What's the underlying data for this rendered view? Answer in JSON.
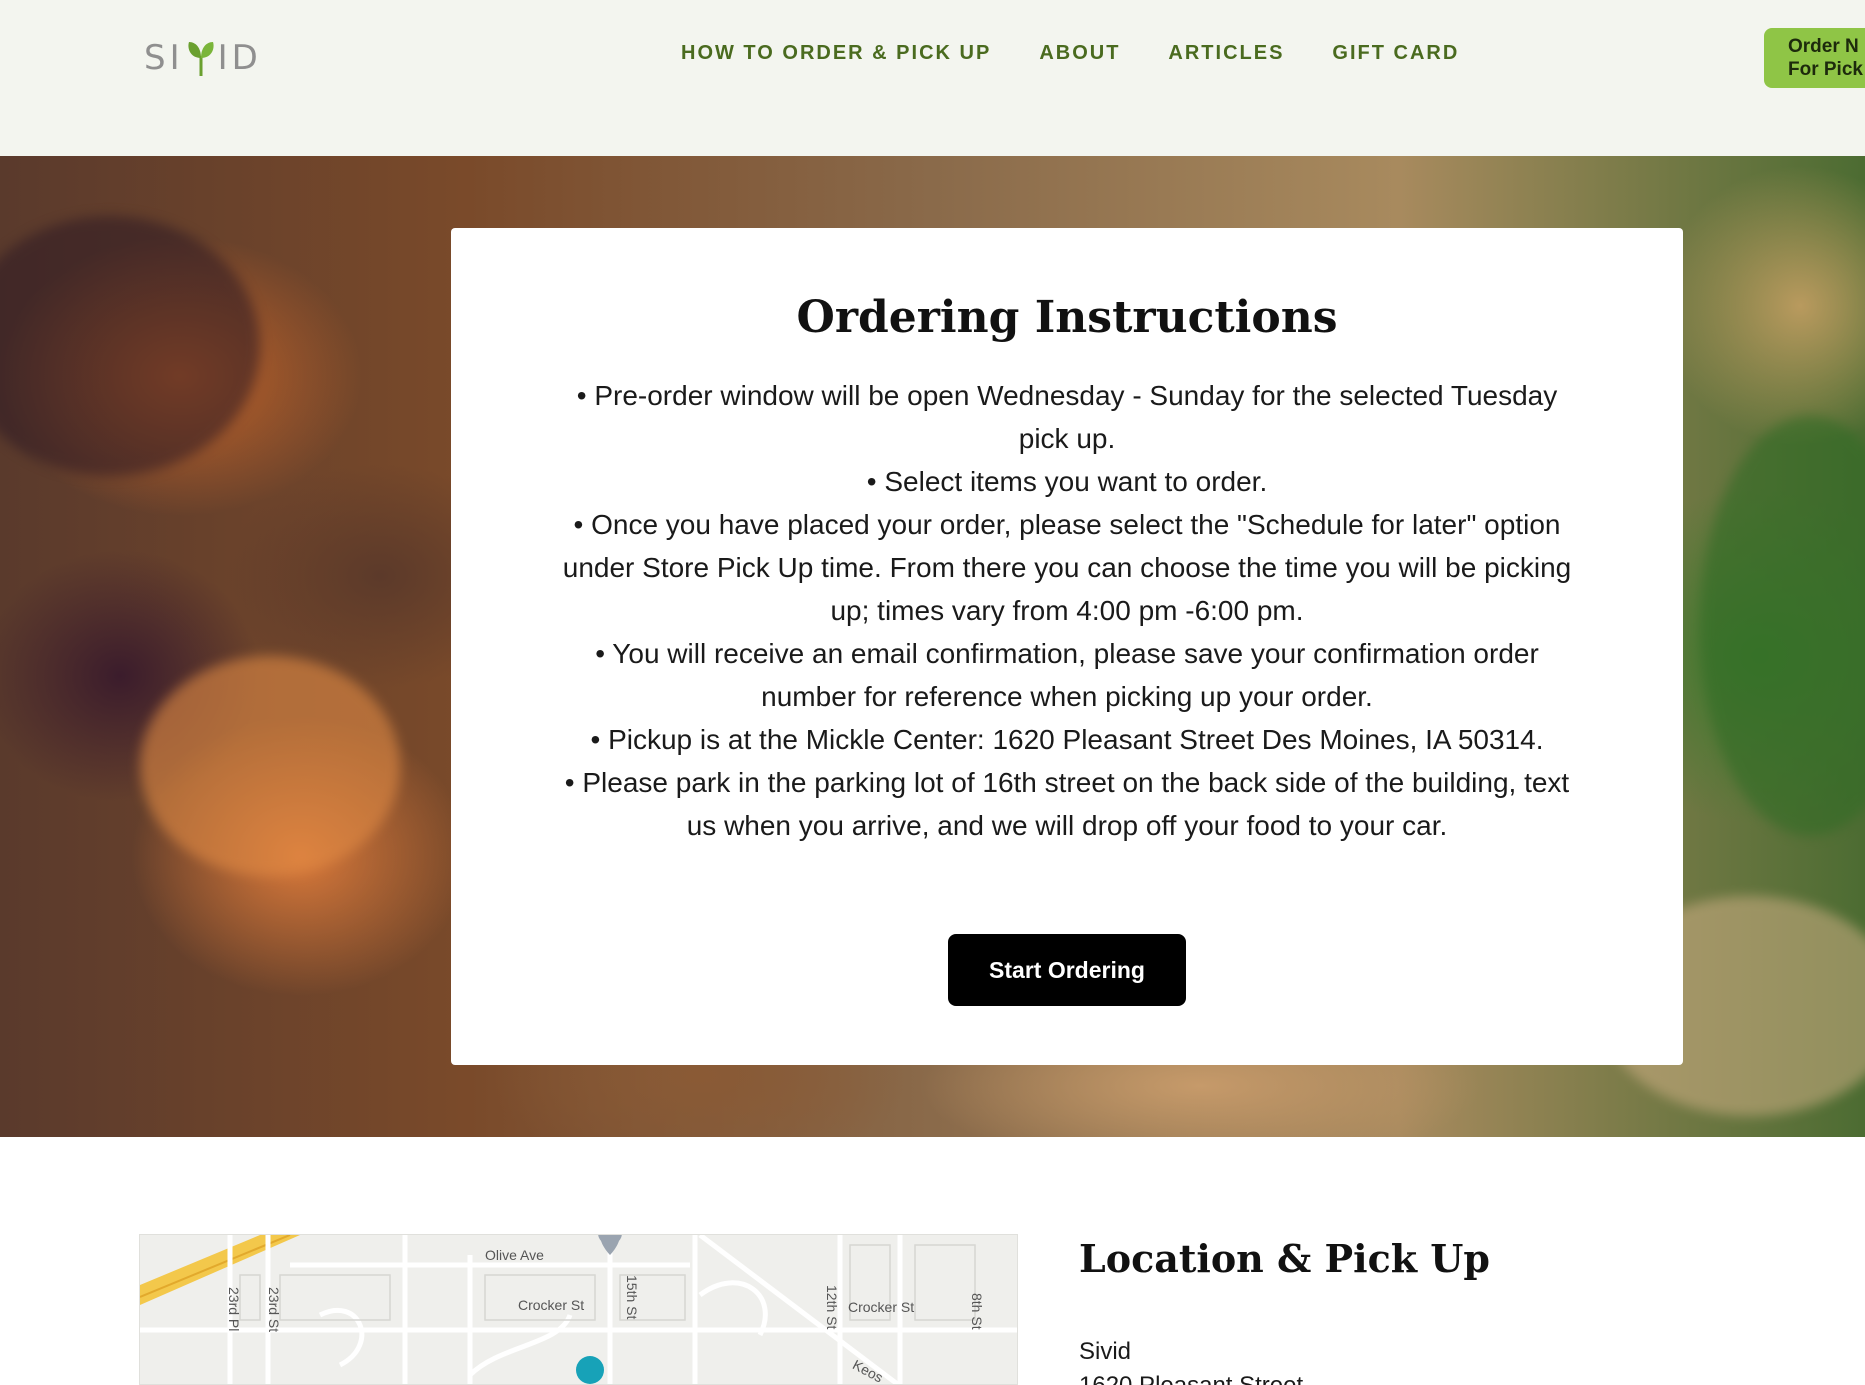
{
  "header": {
    "logo_text": "SIVID",
    "nav": [
      {
        "label": "HOW TO ORDER & PICK UP"
      },
      {
        "label": "ABOUT"
      },
      {
        "label": "ARTICLES"
      },
      {
        "label": "GIFT CARD"
      }
    ],
    "order_button_line1": "Order N",
    "order_button_line2": "For Pick"
  },
  "hero": {
    "title": "Ordering Instructions",
    "instructions": [
      "•  Pre-order window will be open Wednesday - Sunday for the selected Tuesday pick up.",
      "• Select items you want to order.",
      "• Once you have placed your order, please select the \"Schedule for later\" option under Store Pick Up time. From there you can choose the time you will be picking up; times vary from 4:00 pm -6:00 pm.",
      "• You will receive an email confirmation, please save your confirmation order number for reference when picking up your order.",
      "• Pickup is at the Mickle Center: 1620 Pleasant Street Des Moines, IA 50314.",
      "• Please park in the parking lot of 16th street on the back side of the building, text us when you arrive, and we will drop off your food to your car."
    ],
    "cta_label": "Start Ordering"
  },
  "map": {
    "labels": {
      "olive": "Olive Ave",
      "crocker1": "Crocker St",
      "crocker2": "Crocker St",
      "st23pl": "23rd Pl",
      "st23": "23rd St",
      "st15": "15th St",
      "st12": "12th St",
      "st8": "8th St",
      "keosauqua": "Keos"
    }
  },
  "location": {
    "title": "Location & Pick Up",
    "name": "Sivid",
    "street": "1620 Pleasant Street"
  },
  "colors": {
    "header_bg": "#f3f5ef",
    "nav_text": "#4a6b1f",
    "order_button": "#8fc546",
    "cta_bg": "#000000"
  }
}
